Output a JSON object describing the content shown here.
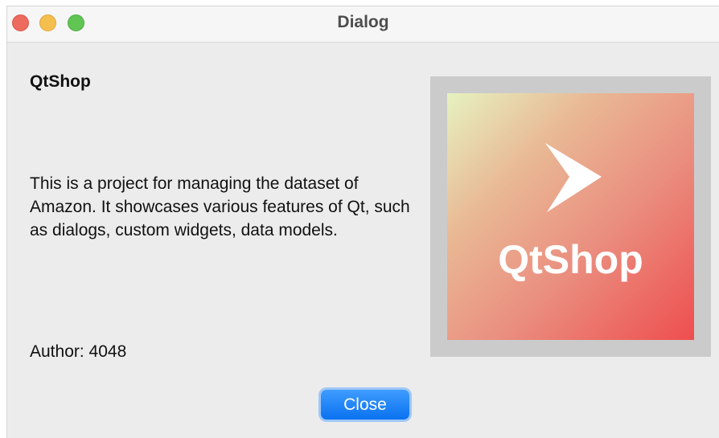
{
  "window": {
    "title": "Dialog"
  },
  "content": {
    "heading": "QtShop",
    "description": "This is a project for managing the dataset of Amazon. It showcases various features of Qt, such as dialogs, custom widgets, data models.",
    "author": "Author: 4048"
  },
  "logo": {
    "text": "QtShop",
    "icon": "play-arrow-icon",
    "gradient_colors": [
      "#e6f2c1",
      "#ea8f80",
      "#ee4e4e"
    ]
  },
  "buttons": {
    "close_label": "Close"
  },
  "colors": {
    "accent": "#0a72f0",
    "traffic_red": "#ed6a5e",
    "traffic_yellow": "#f5bf4f",
    "traffic_green": "#61c554"
  }
}
